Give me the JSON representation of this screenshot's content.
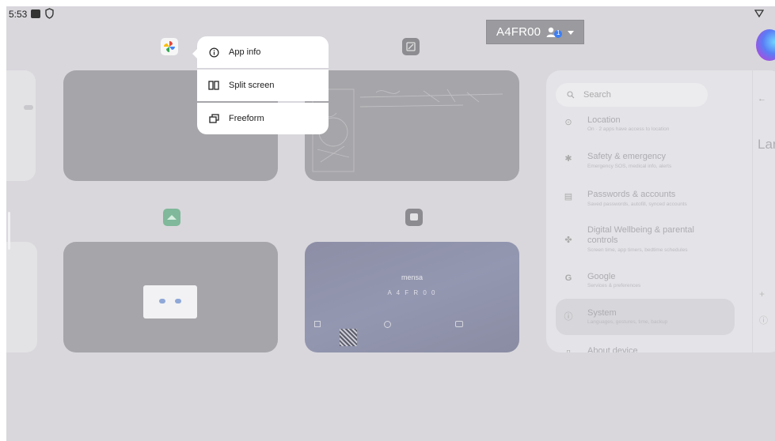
{
  "status_bar": {
    "time": "5:53",
    "icons": [
      "notification-icon",
      "shield-icon",
      "wifi-icon"
    ]
  },
  "account": {
    "name": "A4FR00",
    "badge_count": "1"
  },
  "context_menu": {
    "items": [
      {
        "label": "App info",
        "icon": "info-icon"
      },
      {
        "label": "Split screen",
        "icon": "split-screen-icon"
      },
      {
        "label": "Freeform",
        "icon": "freeform-icon"
      }
    ]
  },
  "recents": {
    "apps": [
      {
        "icon": "photos-icon"
      },
      {
        "icon": "whiteboard-icon"
      },
      {
        "icon": "drive-icon"
      },
      {
        "icon": "mensa-icon"
      }
    ],
    "mensa_card": {
      "title": "mensa",
      "code": "A 4 F R 0 0"
    }
  },
  "settings": {
    "search_placeholder": "Search",
    "items": [
      {
        "title": "Location",
        "subtitle": "On · 2 apps have access to location",
        "icon": "location-icon"
      },
      {
        "title": "Safety & emergency",
        "subtitle": "Emergency SOS, medical info, alerts",
        "icon": "asterisk-icon"
      },
      {
        "title": "Passwords & accounts",
        "subtitle": "Saved passwords, autofill, synced accounts",
        "icon": "accounts-icon"
      },
      {
        "title": "Digital Wellbeing & parental controls",
        "subtitle": "Screen time, app timers, bedtime schedules",
        "icon": "wellbeing-icon"
      },
      {
        "title": "Google",
        "subtitle": "Services & preferences",
        "icon": "google-icon"
      },
      {
        "title": "System",
        "subtitle": "Languages, gestures, time, backup",
        "icon": "system-info-icon"
      },
      {
        "title": "About device",
        "subtitle": "",
        "icon": "phone-icon"
      }
    ],
    "right_pane": {
      "back_glyph": "←",
      "heading": "Lar"
    }
  },
  "colors": {
    "screen_bg": "#d9d7dc",
    "card_bg": "#a6a5a9",
    "menu_bg": "#ffffff",
    "accent_blue": "#3d7ff5"
  }
}
